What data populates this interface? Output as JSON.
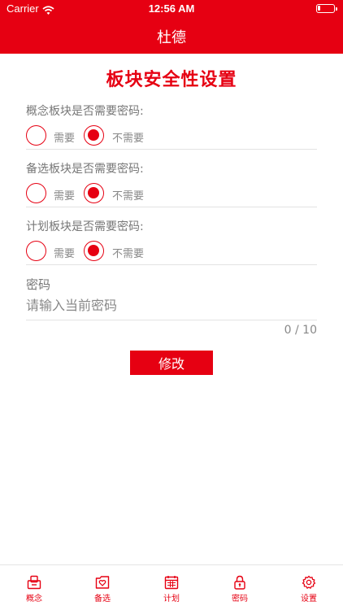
{
  "status_bar": {
    "carrier": "Carrier",
    "time": "12:56 AM",
    "battery_level": 0.15,
    "icons": [
      "wifi-icon",
      "battery-icon"
    ]
  },
  "nav": {
    "title": "杜德"
  },
  "page_title": "板块安全性设置",
  "sections": [
    {
      "question": "概念板块是否需要密码:",
      "option_yes": "需要",
      "option_no": "不需要",
      "selected": "不需要"
    },
    {
      "question": "备选板块是否需要密码:",
      "option_yes": "需要",
      "option_no": "不需要",
      "selected": "不需要"
    },
    {
      "question": "计划板块是否需要密码:",
      "option_yes": "需要",
      "option_no": "不需要",
      "selected": "不需要"
    }
  ],
  "password": {
    "label": "密码",
    "placeholder": "请输入当前密码",
    "value": "",
    "counter": "0 / 10"
  },
  "submit_label": "修改",
  "tabbar": {
    "items": [
      {
        "label": "概念",
        "icon": "concept-box-icon"
      },
      {
        "label": "备选",
        "icon": "heart-box-icon"
      },
      {
        "label": "计划",
        "icon": "calendar-icon"
      },
      {
        "label": "密码",
        "icon": "lock-icon"
      },
      {
        "label": "设置",
        "icon": "gear-icon"
      }
    ]
  },
  "colors": {
    "brand": "#e60012",
    "text_muted": "#888888",
    "divider": "#e3e3e3"
  }
}
